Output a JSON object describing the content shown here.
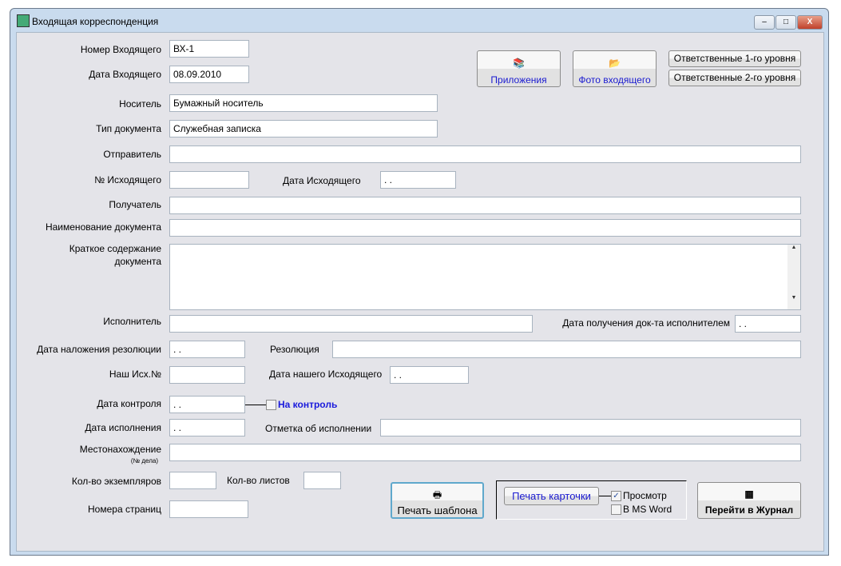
{
  "window": {
    "title": "Входящая корреспонденция",
    "minimize": "–",
    "maximize": "□",
    "close": "X"
  },
  "fields": {
    "incoming_no": {
      "label": "Номер Входящего",
      "value": "ВХ-1"
    },
    "incoming_date": {
      "label": "Дата Входящего",
      "value": "08.09.2010"
    },
    "carrier": {
      "label": "Носитель",
      "value": "Бумажный носитель"
    },
    "doc_type": {
      "label": "Тип документа",
      "value": "Служебная записка"
    },
    "sender": {
      "label": "Отправитель",
      "value": ""
    },
    "outgoing_no": {
      "label": "№ Исходящего",
      "value": ""
    },
    "outgoing_date": {
      "label": "Дата Исходящего",
      "value": ". ."
    },
    "recipient": {
      "label": "Получатель",
      "value": ""
    },
    "doc_name": {
      "label": "Наименование документа",
      "value": ""
    },
    "summary": {
      "label1": "Краткое содержание",
      "label2": "документа",
      "value": ""
    },
    "executor": {
      "label": "Исполнитель",
      "value": ""
    },
    "exec_received_date": {
      "label": "Дата получения док-та исполнителем",
      "value": ". ."
    },
    "resolution_date": {
      "label": "Дата наложения резолюции",
      "value": ". ."
    },
    "resolution": {
      "label": "Резолюция",
      "value": ""
    },
    "our_out_no": {
      "label": "Наш Исх.№",
      "value": ""
    },
    "our_out_date": {
      "label": "Дата нашего Исходящего",
      "value": ". ."
    },
    "control_date": {
      "label": "Дата контроля",
      "value": ". .",
      "checkbox": "На контроль"
    },
    "done_date": {
      "label": "Дата исполнения",
      "value": ". ."
    },
    "done_mark": {
      "label": "Отметка об исполнении",
      "value": ""
    },
    "location": {
      "label": "Местонахождение",
      "sub": "(№ дела)",
      "value": ""
    },
    "copies": {
      "label": "Кол-во экземпляров",
      "value": ""
    },
    "sheets": {
      "label": "Кол-во листов",
      "value": ""
    },
    "pages": {
      "label": "Номера страниц",
      "value": ""
    }
  },
  "buttons": {
    "attachments": "Приложения",
    "photo": "Фото входящего",
    "resp1": "Ответственные 1-го уровня",
    "resp2": "Ответственные 2-го уровня",
    "print_template": "Печать шаблона",
    "print_card": "Печать карточки",
    "preview": "Просмотр",
    "ms_word": "В MS Word",
    "journal": "Перейти в Журнал"
  },
  "checks": {
    "preview": true,
    "ms_word": false,
    "control": false
  }
}
